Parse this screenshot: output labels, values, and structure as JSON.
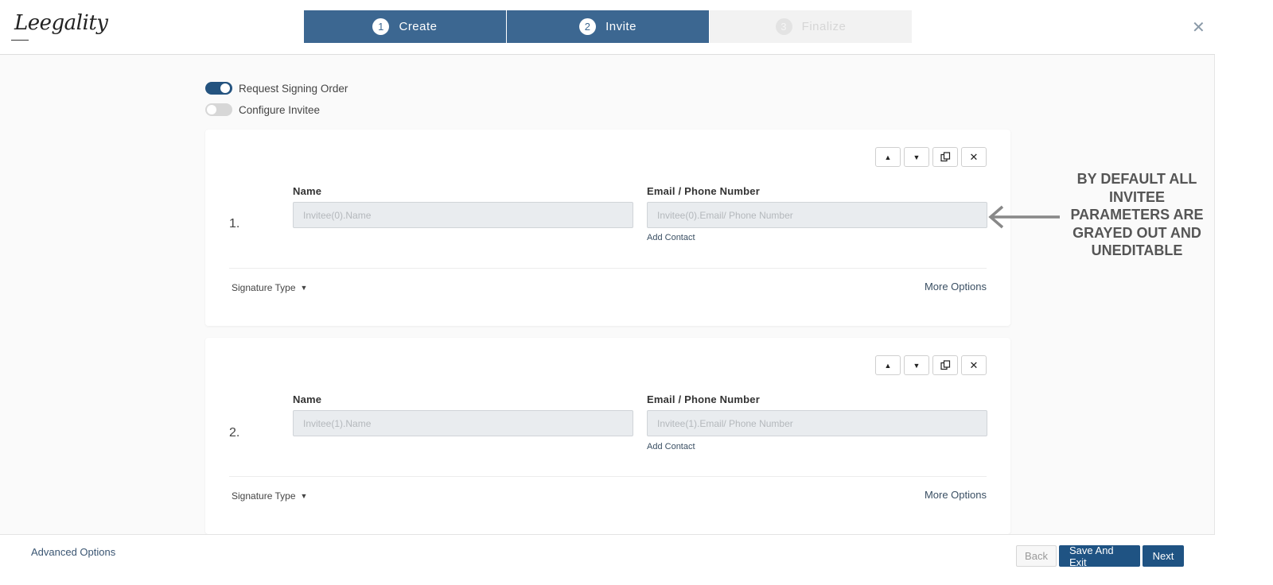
{
  "header": {
    "logo_text": "Leegality",
    "steps": [
      {
        "number": "1",
        "label": "Create",
        "state": "active"
      },
      {
        "number": "2",
        "label": "Invite",
        "state": "active"
      },
      {
        "number": "3",
        "label": "Finalize",
        "state": "inactive"
      }
    ],
    "close_icon": "close-icon"
  },
  "toggles": [
    {
      "label": "Request Signing Order",
      "on": true
    },
    {
      "label": "Configure Invitee",
      "on": false
    }
  ],
  "invitees": [
    {
      "index": "1.",
      "name_label": "Name",
      "name_placeholder": "Invitee(0).Name",
      "email_label": "Email / Phone Number",
      "email_placeholder": "Invitee(0).Email/ Phone Number",
      "add_contact": "Add Contact",
      "signature_type": "Signature Type",
      "more_options": "More Options"
    },
    {
      "index": "2.",
      "name_label": "Name",
      "name_placeholder": "Invitee(1).Name",
      "email_label": "Email / Phone Number",
      "email_placeholder": "Invitee(1).Email/ Phone Number",
      "add_contact": "Add Contact",
      "signature_type": "Signature Type",
      "more_options": "More Options"
    }
  ],
  "annotation": {
    "text": "BY DEFAULT ALL INVITEE PARAMETERS ARE GRAYED OUT AND UNEDITABLE",
    "color": "#555555"
  },
  "footer": {
    "advanced_options": "Advanced Options",
    "back_label": "Back",
    "save_exit_label": "Save And Exit",
    "next_label": "Next"
  },
  "colors": {
    "primary": "#1f5383",
    "step_active": "#3c6791",
    "input_disabled": "#e9ecef"
  }
}
